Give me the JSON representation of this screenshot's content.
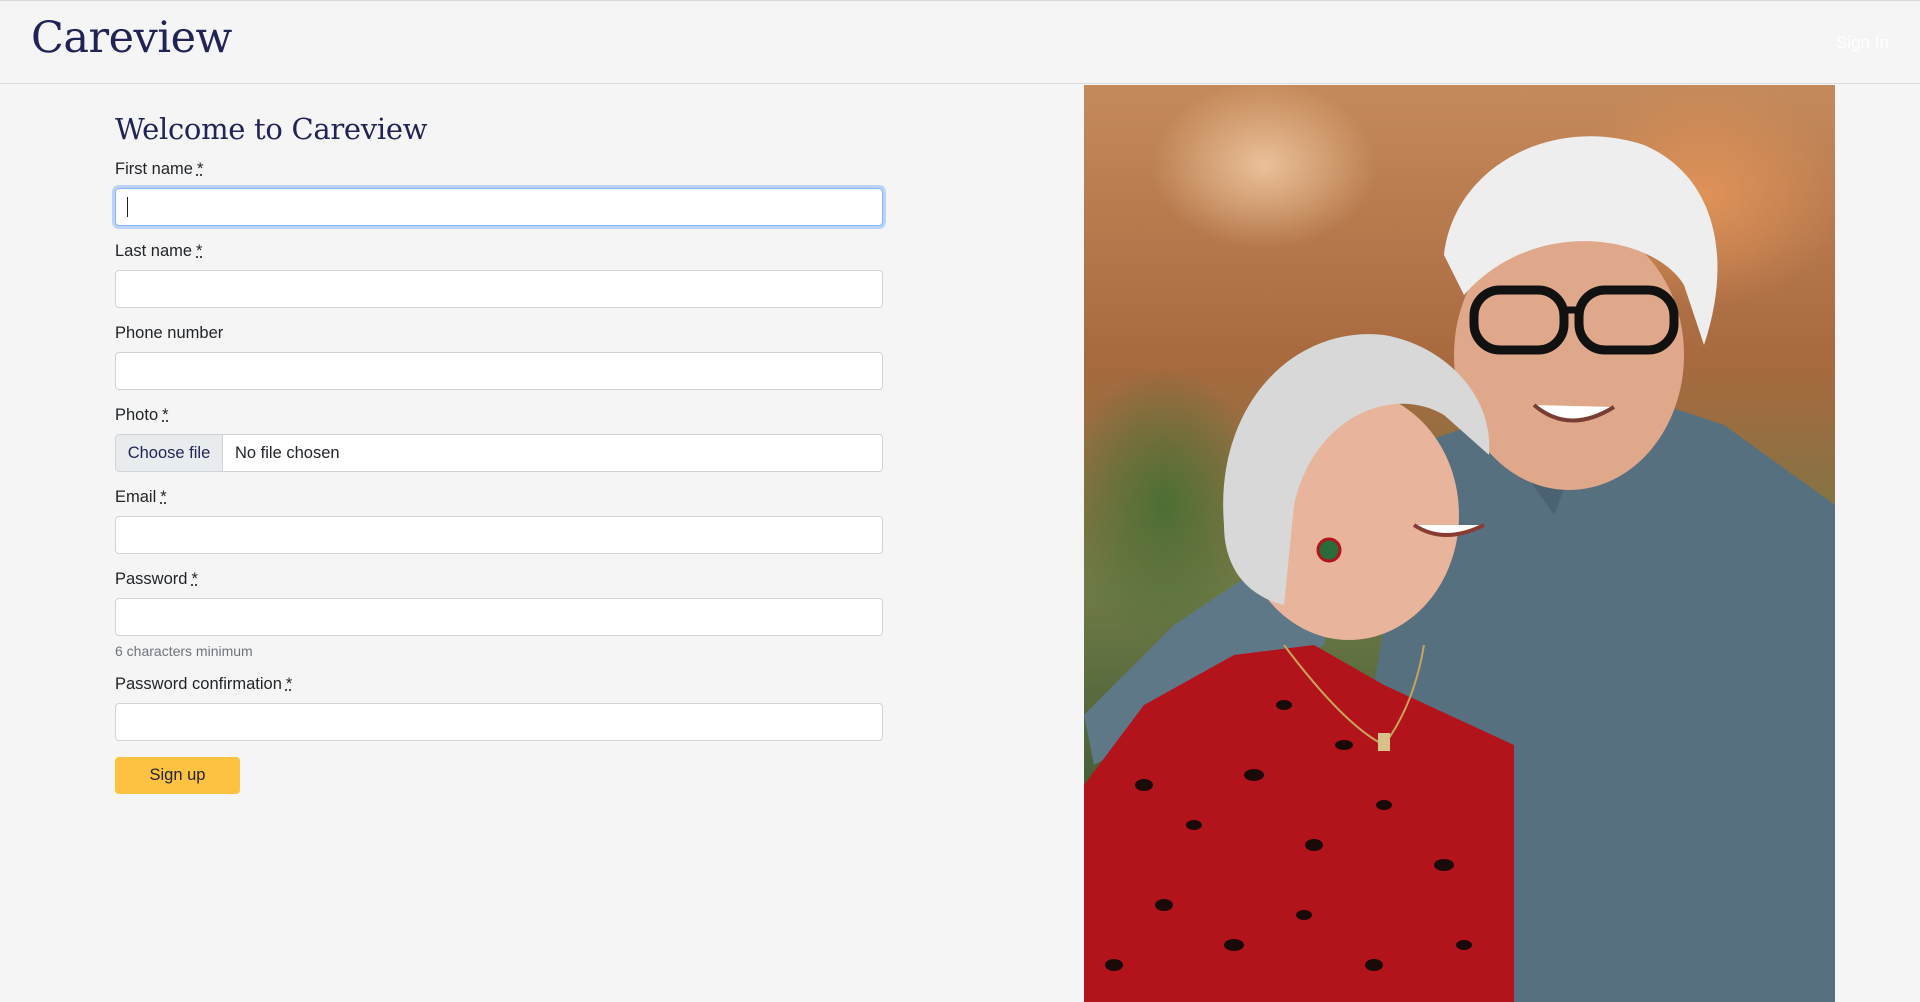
{
  "header": {
    "brand": "Careview",
    "signin_label": "Sign In"
  },
  "form": {
    "title": "Welcome to Careview",
    "required_marker": "*",
    "fields": {
      "first_name": {
        "label": "First name",
        "value": ""
      },
      "last_name": {
        "label": "Last name",
        "value": ""
      },
      "phone": {
        "label": "Phone number",
        "value": ""
      },
      "photo": {
        "label": "Photo",
        "button_label": "Choose file",
        "status": "No file chosen"
      },
      "email": {
        "label": "Email",
        "value": ""
      },
      "password": {
        "label": "Password",
        "value": "",
        "hint": "6 characters minimum"
      },
      "password_confirmation": {
        "label": "Password confirmation",
        "value": ""
      }
    },
    "submit_label": "Sign up"
  },
  "colors": {
    "brand": "#1f2356",
    "button": "#fec242",
    "background": "#f5f5f5"
  }
}
